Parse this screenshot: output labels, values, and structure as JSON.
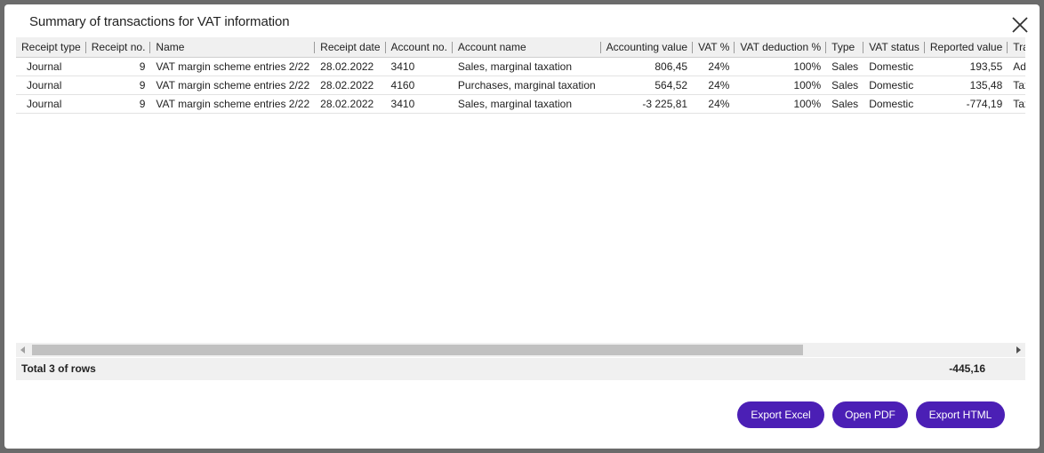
{
  "dialog": {
    "title": "Summary of transactions for VAT information"
  },
  "table": {
    "columns": [
      {
        "label": "Receipt type",
        "align": "left"
      },
      {
        "label": "Receipt no.",
        "align": "right"
      },
      {
        "label": "Name",
        "align": "left"
      },
      {
        "label": "Receipt date",
        "align": "left"
      },
      {
        "label": "Account no.",
        "align": "left"
      },
      {
        "label": "Account name",
        "align": "left"
      },
      {
        "label": "Accounting value",
        "align": "right"
      },
      {
        "label": "VAT %",
        "align": "right"
      },
      {
        "label": "VAT deduction %",
        "align": "right"
      },
      {
        "label": "Type",
        "align": "left"
      },
      {
        "label": "VAT status",
        "align": "left"
      },
      {
        "label": "Reported value",
        "align": "right"
      },
      {
        "label": "Transact",
        "align": "left"
      }
    ],
    "rows": [
      [
        "Journal",
        "9",
        "VAT margin scheme entries 2/22",
        "28.02.2022",
        "3410",
        "Sales, marginal taxation",
        "806,45",
        "24%",
        "100%",
        "Sales",
        "Domestic",
        "193,55",
        "Adjuster"
      ],
      [
        "Journal",
        "9",
        "VAT margin scheme entries 2/22",
        "28.02.2022",
        "4160",
        "Purchases, marginal taxation",
        "564,52",
        "24%",
        "100%",
        "Sales",
        "Domestic",
        "135,48",
        "Tax base"
      ],
      [
        "Journal",
        "9",
        "VAT margin scheme entries 2/22",
        "28.02.2022",
        "3410",
        "Sales, marginal taxation",
        "-3 225,81",
        "24%",
        "100%",
        "Sales",
        "Domestic",
        "-774,19",
        "Tax base"
      ]
    ]
  },
  "footer": {
    "total_label": "Total 3 of rows",
    "total_value": "-445,16"
  },
  "buttons": {
    "export_excel": "Export Excel",
    "open_pdf": "Open PDF",
    "export_html": "Export HTML"
  },
  "colors": {
    "button_bg": "#4b1fb5",
    "header_bg": "#f0f0f0"
  },
  "icons": {
    "close": "close-icon"
  }
}
